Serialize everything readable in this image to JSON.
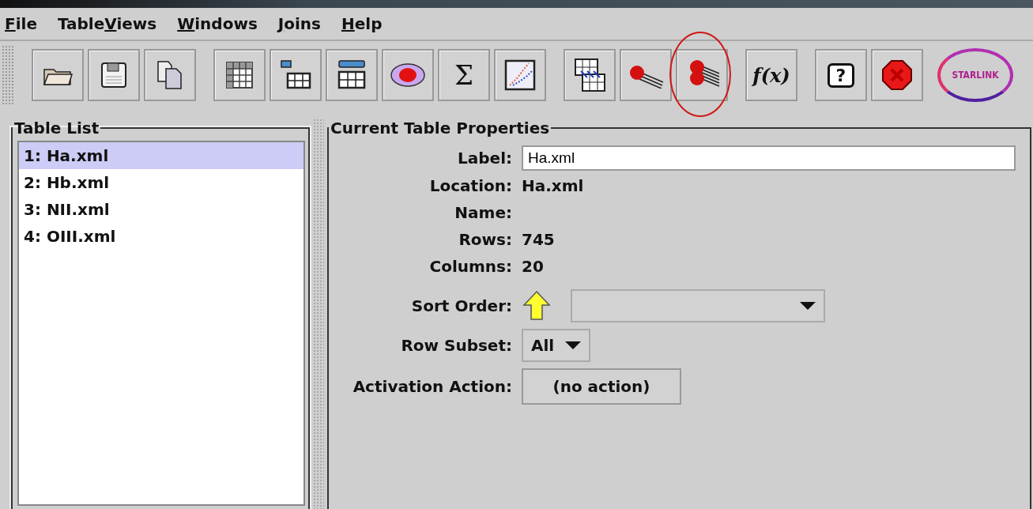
{
  "menu": [
    {
      "key": "F",
      "after": "ile"
    },
    {
      "before": "Table",
      "key": "V",
      "after": "iews"
    },
    {
      "key": "W",
      "after": "indows"
    },
    {
      "key": "J",
      "after": "oins"
    },
    {
      "key": "H",
      "after": "elp"
    }
  ],
  "toolbar": {
    "groups": [
      {
        "buttons": [
          {
            "highlighted": false
          },
          {
            "highlighted": false
          },
          {
            "highlighted": false
          }
        ]
      },
      {
        "buttons": [
          {
            "highlighted": false
          },
          {
            "highlighted": false
          },
          {
            "highlighted": false
          },
          {
            "highlighted": false
          },
          {
            "highlighted": false,
            "glyph": "Σ"
          },
          {
            "highlighted": false
          }
        ]
      },
      {
        "buttons": [
          {
            "highlighted": false
          },
          {
            "highlighted": false
          },
          {
            "highlighted": true
          }
        ]
      },
      {
        "buttons": [
          {
            "highlighted": false,
            "glyph": "f(x)"
          }
        ]
      },
      {
        "buttons": [
          {
            "highlighted": false,
            "glyph": "?"
          },
          {
            "highlighted": false
          }
        ]
      }
    ],
    "logo_text": "STARLINK"
  },
  "table_list": {
    "title": "Table List",
    "items": [
      {
        "label": "1: Ha.xml",
        "selected": true
      },
      {
        "label": "2: Hb.xml",
        "selected": false
      },
      {
        "label": "3: NII.xml",
        "selected": false
      },
      {
        "label": "4: OIII.xml",
        "selected": false
      }
    ]
  },
  "properties": {
    "title": "Current Table Properties",
    "rows": [
      {
        "kind": "field",
        "label": "Label:",
        "value": "Ha.xml"
      },
      {
        "kind": "text",
        "label": "Location:",
        "value": "Ha.xml"
      },
      {
        "kind": "text",
        "label": "Name:"
      },
      {
        "kind": "text",
        "label": "Rows:",
        "value": "745"
      },
      {
        "kind": "text",
        "label": "Columns:",
        "value": "20"
      },
      {
        "kind": "sort",
        "label": "Sort Order:"
      },
      {
        "kind": "combo",
        "label": "Row Subset:",
        "value": "All"
      },
      {
        "kind": "button",
        "label": "Activation Action:",
        "value": "(no action)"
      }
    ]
  }
}
